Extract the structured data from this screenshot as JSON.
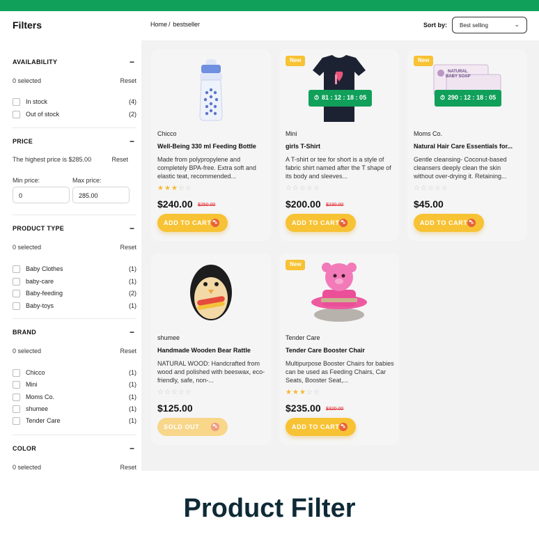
{
  "sidebar": {
    "title": "Filters",
    "availability": {
      "title": "AVAILABILITY",
      "selected": "0 selected",
      "reset": "Reset",
      "options": [
        {
          "label": "In stock",
          "count": "(4)"
        },
        {
          "label": "Out of stock",
          "count": "(2)"
        }
      ]
    },
    "price": {
      "title": "PRICE",
      "info": "The highest price is $285.00",
      "reset": "Reset",
      "min_label": "Min price:",
      "max_label": "Max price:",
      "min_value": "0",
      "max_value": "285.00"
    },
    "product_type": {
      "title": "PRODUCT TYPE",
      "selected": "0 selected",
      "reset": "Reset",
      "options": [
        {
          "label": "Baby Clothes",
          "count": "(1)"
        },
        {
          "label": "baby-care",
          "count": "(1)"
        },
        {
          "label": "Baby-feeding",
          "count": "(2)"
        },
        {
          "label": "Baby-toys",
          "count": "(1)"
        }
      ]
    },
    "brand": {
      "title": "BRAND",
      "selected": "0 selected",
      "reset": "Reset",
      "options": [
        {
          "label": "Chicco",
          "count": "(1)"
        },
        {
          "label": "Mini",
          "count": "(1)"
        },
        {
          "label": "Moms Co.",
          "count": "(1)"
        },
        {
          "label": "shumee",
          "count": "(1)"
        },
        {
          "label": "Tender Care",
          "count": "(1)"
        }
      ]
    },
    "color": {
      "title": "COLOR",
      "selected": "0 selected",
      "reset": "Reset"
    },
    "collapse_symbol": "−"
  },
  "header": {
    "breadcrumb": {
      "home": "Home",
      "separator": "/",
      "current": "bestseller"
    },
    "sort_label": "Sort by:",
    "sort_value": "Best selling",
    "sort_chevron": "⌄"
  },
  "products": [
    {
      "badge": "",
      "timer": "",
      "brand": "Chicco",
      "title": "Well-Being 330 ml Feeding Bottle",
      "description": "Made from polypropylene and completely BPA-free. Extra soft and elastic teat, recommended...",
      "rating": 3,
      "price": "$240.00",
      "old_price": "$250.00",
      "button": "ADD TO CART"
    },
    {
      "badge": "New",
      "timer": "81 : 12 : 18 : 05",
      "brand": "Mini",
      "title": "girls T-Shirt",
      "description": "A T-shirt or tee for short is a style of fabric shirt named after the T shape of its body and sleeves...",
      "rating": 0,
      "price": "$200.00",
      "old_price": "$230.00",
      "button": "ADD TO CART"
    },
    {
      "badge": "New",
      "timer": "290 : 12 : 18 : 05",
      "brand": "Moms Co.",
      "title": "Natural Hair Care Essentials for...",
      "description": "Gentle cleansing- Coconut-based cleansers deeply clean the skin without over-drying it. Retaining...",
      "rating": 0,
      "price": "$45.00",
      "old_price": "",
      "button": "ADD TO CART"
    },
    {
      "badge": "",
      "timer": "",
      "brand": "shumee",
      "title": "Handmade Wooden Bear Rattle",
      "description": "NATURAL WOOD: Handcrafted from wood and polished with beeswax, eco-friendly, safe, non-...",
      "rating": 0,
      "price": "$125.00",
      "old_price": "",
      "button": "SOLD OUT"
    },
    {
      "badge": "New",
      "timer": "",
      "brand": "Tender Care",
      "title": "Tender Care Booster Chair",
      "description": "Multipurpose Booster Chairs for babies can be used as Feeding Chairs, Car Seats, Booster Seat,...",
      "rating": 3,
      "price": "$235.00",
      "old_price": "$320.00",
      "button": "ADD TO CART"
    }
  ],
  "image_text": {
    "soap_line1": "NATURAL",
    "soap_line2": "BABY SOAP"
  },
  "caption": "Product Filter",
  "colors": {
    "top_bar": "#10a05a",
    "accent_yellow": "#f7c233",
    "timer_green": "#10a05a",
    "old_price_red": "#e0262b",
    "caption_text": "#0f2a37"
  },
  "icons": {
    "timer": "stopwatch-icon",
    "cart": "cart-icon",
    "star": "star-icon",
    "chevron": "chevron-down-icon",
    "collapse": "minus-icon",
    "checkbox": "checkbox-icon"
  }
}
